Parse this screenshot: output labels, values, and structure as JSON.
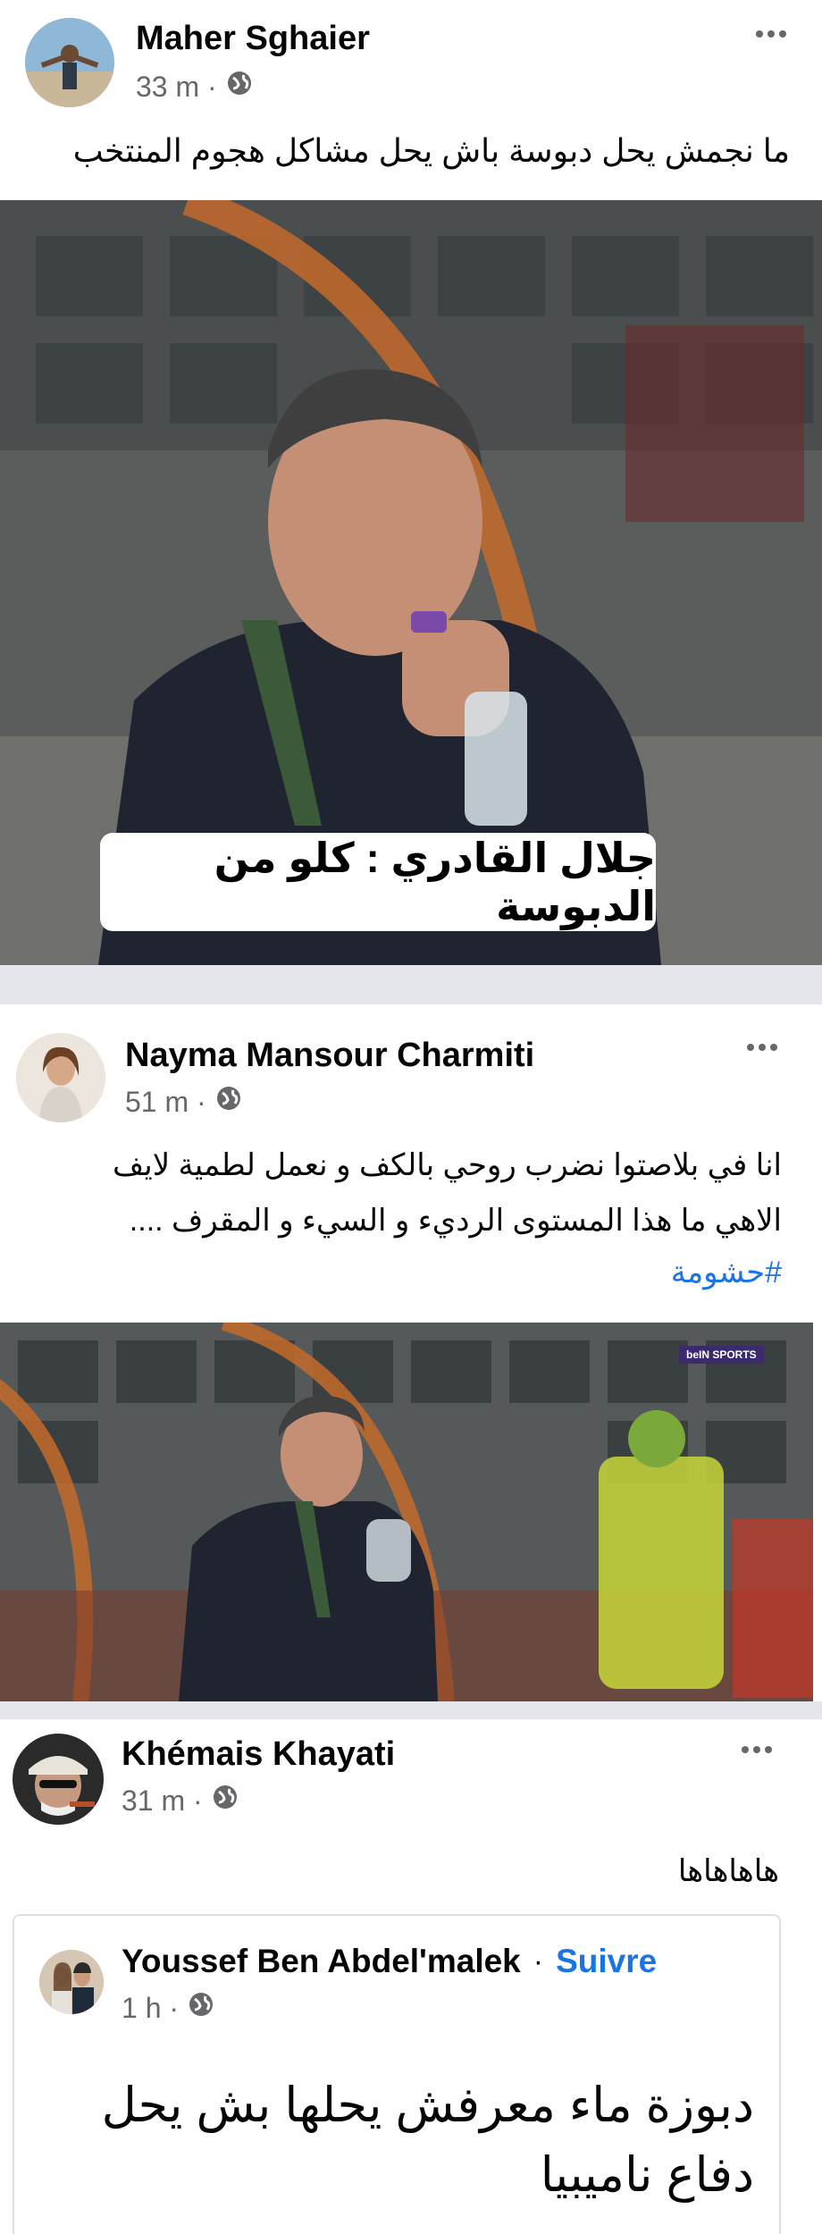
{
  "posts": [
    {
      "author": "Maher Sghaier",
      "time": "33 m ·",
      "text": "ما نجمش يحل دبوسة باش يحل مشاكل هجوم المنتخب",
      "image_caption": "جلال القادري : كلو من الدبوسة"
    },
    {
      "author": "Nayma Mansour Charmiti",
      "time": "51 m ·",
      "text_line1": "انا في بلاصتوا نضرب روحي بالكف و نعمل لطمية لايف",
      "text_line2": "الاهي ما هذا المستوى الرديء و السيء و المقرف ....",
      "hashtag": "#حشومة",
      "broadcast_badge": "beIN SPORTS"
    },
    {
      "author": "Khémais Khayati",
      "time": "31 m ·",
      "text": "هاهاهاها",
      "shared": {
        "author": "Youssef Ben Abdel'malek",
        "dot": "·",
        "follow_label": "Suivre",
        "time": "1 h ·",
        "text_line1": "دبوزة ماء معرفش يحلها بش يحل",
        "text_line2": "دفاع ناميبيا"
      }
    }
  ],
  "colors": {
    "link_blue": "#1b74e4",
    "meta_gray": "#65676b",
    "divider": "#e4e6eb"
  }
}
